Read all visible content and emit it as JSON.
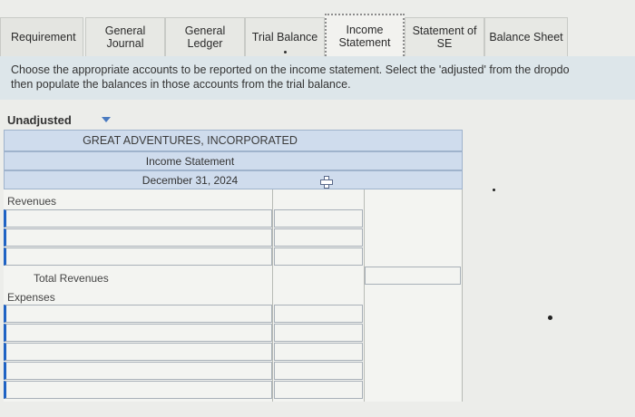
{
  "tabs": [
    {
      "label": "Requirement"
    },
    {
      "label": "General\nJournal"
    },
    {
      "label": "General\nLedger"
    },
    {
      "label": "Trial Balance"
    },
    {
      "label": "Income\nStatement"
    },
    {
      "label": "Statement of\nSE"
    },
    {
      "label": "Balance Sheet"
    }
  ],
  "instruction": {
    "line1": "Choose the appropriate accounts to be reported on the income statement. Select the 'adjusted' from the dropdo",
    "line2": "then populate the balances in those accounts from the trial balance."
  },
  "dropdown": {
    "selected": "Unadjusted"
  },
  "statement": {
    "company": "GREAT ADVENTURES, INCORPORATED",
    "title": "Income Statement",
    "date": "December 31, 2024"
  },
  "labels": {
    "revenues": "Revenues",
    "total_revenues": "Total Revenues",
    "expenses": "Expenses"
  },
  "colors": {
    "header_fill": "#cfdced",
    "input_accent": "#1f63c4",
    "banner": "#dde6ea"
  }
}
